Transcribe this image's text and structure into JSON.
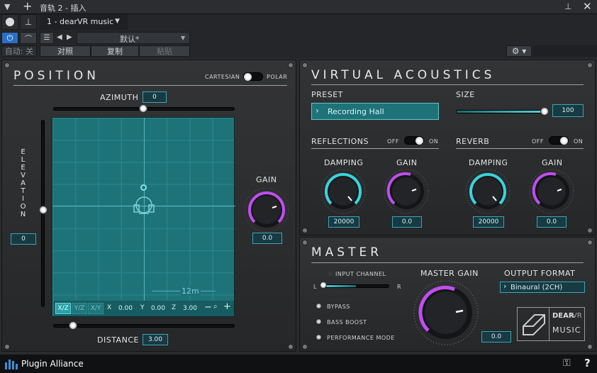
{
  "host": {
    "track_title": "音轨 2 - 插入",
    "plugin_slot": "1 - dearVR music",
    "preset_name": "默认*",
    "auto_label": "自动: 关",
    "compare_label": "对照",
    "copy_label": "复制",
    "paste_label": "粘贴"
  },
  "position": {
    "title": "POSITION",
    "cartesian_label": "CARTESIAN",
    "polar_label": "POLAR",
    "azimuth_label": "AZIMUTH",
    "azimuth_value": "0",
    "elevation_label": "ELEVATION",
    "elevation_value": "0",
    "gain_label": "GAIN",
    "gain_value": "0.0",
    "distance_label": "DISTANCE",
    "distance_value": "3.00",
    "scale_label": "12m",
    "view_xz": "X/Z",
    "view_yz": "Y/Z",
    "view_xy": "X/Y",
    "x_label": "X",
    "x_value": "0.00",
    "y_label": "Y",
    "y_value": "0.00",
    "z_label": "Z",
    "z_value": "3.00",
    "zoom_minus": "−",
    "zoom_plus": "+"
  },
  "virtual_acoustics": {
    "title": "VIRTUAL ACOUSTICS",
    "preset_label": "PRESET",
    "preset_value": "Recording Hall",
    "size_label": "SIZE",
    "size_value": "100",
    "reflections_label": "REFLECTIONS",
    "reverb_label": "REVERB",
    "off_label": "OFF",
    "on_label": "ON",
    "damping_label": "DAMPING",
    "gain_label": "GAIN",
    "refl_damping_value": "20000",
    "refl_gain_value": "0.0",
    "rev_damping_value": "20000",
    "rev_gain_value": "0.0"
  },
  "master": {
    "title": "MASTER",
    "input_channel_label": "INPUT CHANNEL",
    "l_label": "L",
    "r_label": "R",
    "bypass_label": "BYPASS",
    "bass_boost_label": "BASS BOOST",
    "performance_mode_label": "PERFORMANCE MODE",
    "master_gain_label": "MASTER GAIN",
    "master_gain_value": "0.0",
    "output_format_label": "OUTPUT FORMAT",
    "output_format_value": "Binaural (2CH)",
    "logo_dear": "DEAR",
    "logo_vr": "VR",
    "logo_music": "MUSIC"
  },
  "footer": {
    "brand": "Plugin Alliance",
    "help": "?"
  },
  "colors": {
    "teal": "#1f7c80",
    "accent_teal": "#38d4dc",
    "purple": "#c04ef0"
  }
}
